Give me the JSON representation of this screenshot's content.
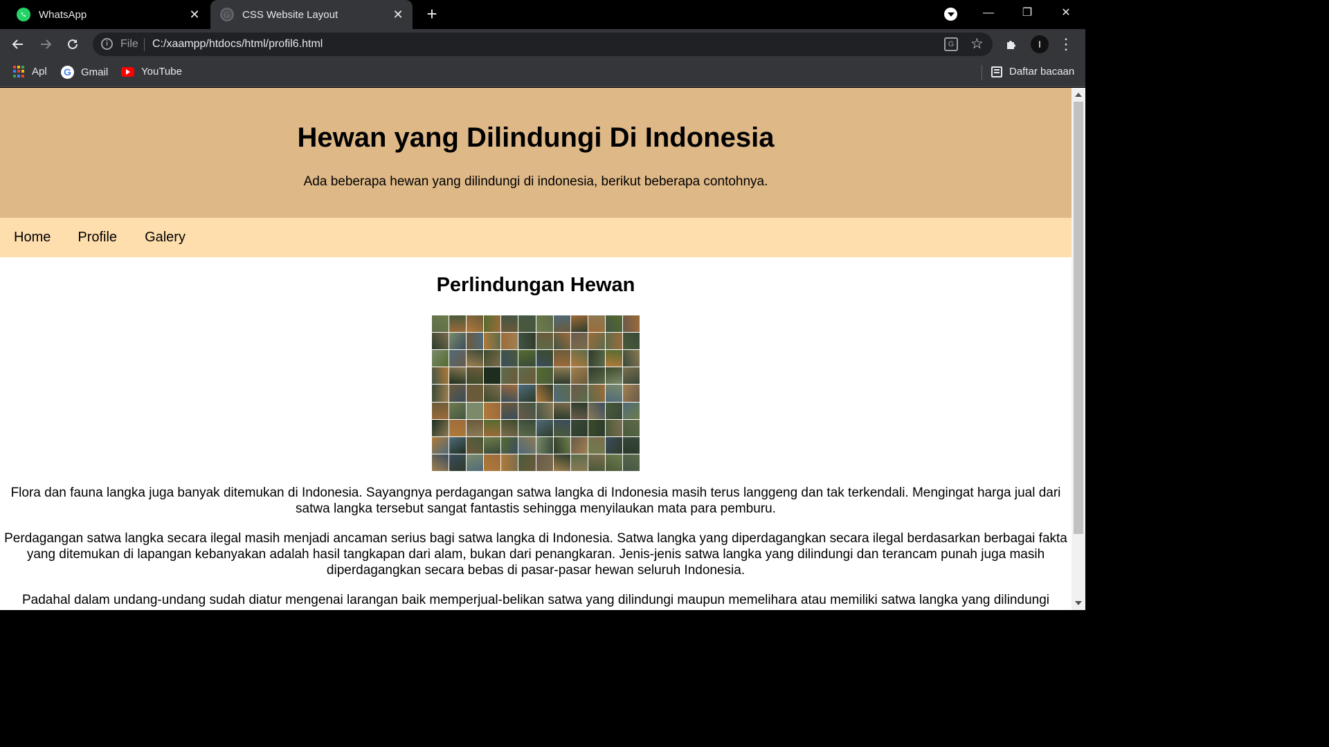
{
  "browser": {
    "tabs": [
      {
        "title": "WhatsApp",
        "favicon": "whatsapp-icon",
        "active": false
      },
      {
        "title": "CSS Website Layout",
        "favicon": "globe-icon",
        "active": true
      }
    ],
    "address_bar": {
      "scheme_label": "File",
      "url": "C:/xaampp/htdocs/html/profil6.html"
    },
    "bookmarks": [
      {
        "label": "Apl",
        "icon": "apps-grid-icon"
      },
      {
        "label": "Gmail",
        "icon": "google-icon"
      },
      {
        "label": "YouTube",
        "icon": "youtube-icon"
      }
    ],
    "reading_list_label": "Daftar bacaan"
  },
  "page": {
    "header": {
      "title": "Hewan yang Dilindungi Di Indonesia",
      "subtitle": "Ada beberapa hewan yang dilindungi di indonesia, berikut beberapa contohnya."
    },
    "nav": [
      "Home",
      "Profile",
      "Galery"
    ],
    "content": {
      "heading": "Perlindungan Hewan",
      "paragraphs": [
        "Flora dan fauna langka juga banyak ditemukan di Indonesia. Sayangnya perdagangan satwa langka di Indonesia masih terus langgeng dan tak terkendali. Mengingat harga jual dari satwa langka tersebut sangat fantastis sehingga menyilaukan mata para pemburu.",
        "Perdagangan satwa langka secara ilegal masih menjadi ancaman serius bagi satwa langka di Indonesia. Satwa langka yang diperdagangkan secara ilegal berdasarkan berbagai fakta yang ditemukan di lapangan kebanyakan adalah hasil tangkapan dari alam, bukan dari penangkaran. Jenis-jenis satwa langka yang dilindungi dan terancam punah juga masih diperdagangkan secara bebas di pasar-pasar hewan seluruh Indonesia.",
        "Padahal dalam undang-undang sudah diatur mengenai larangan baik memperjual-belikan satwa yang dilindungi maupun memelihara atau memiliki satwa langka yang dilindungi"
      ]
    }
  },
  "colors": {
    "header_bg": "#deb887",
    "nav_bg": "#ffdead",
    "chrome_dark": "#35363a",
    "tabstrip": "#000000"
  }
}
